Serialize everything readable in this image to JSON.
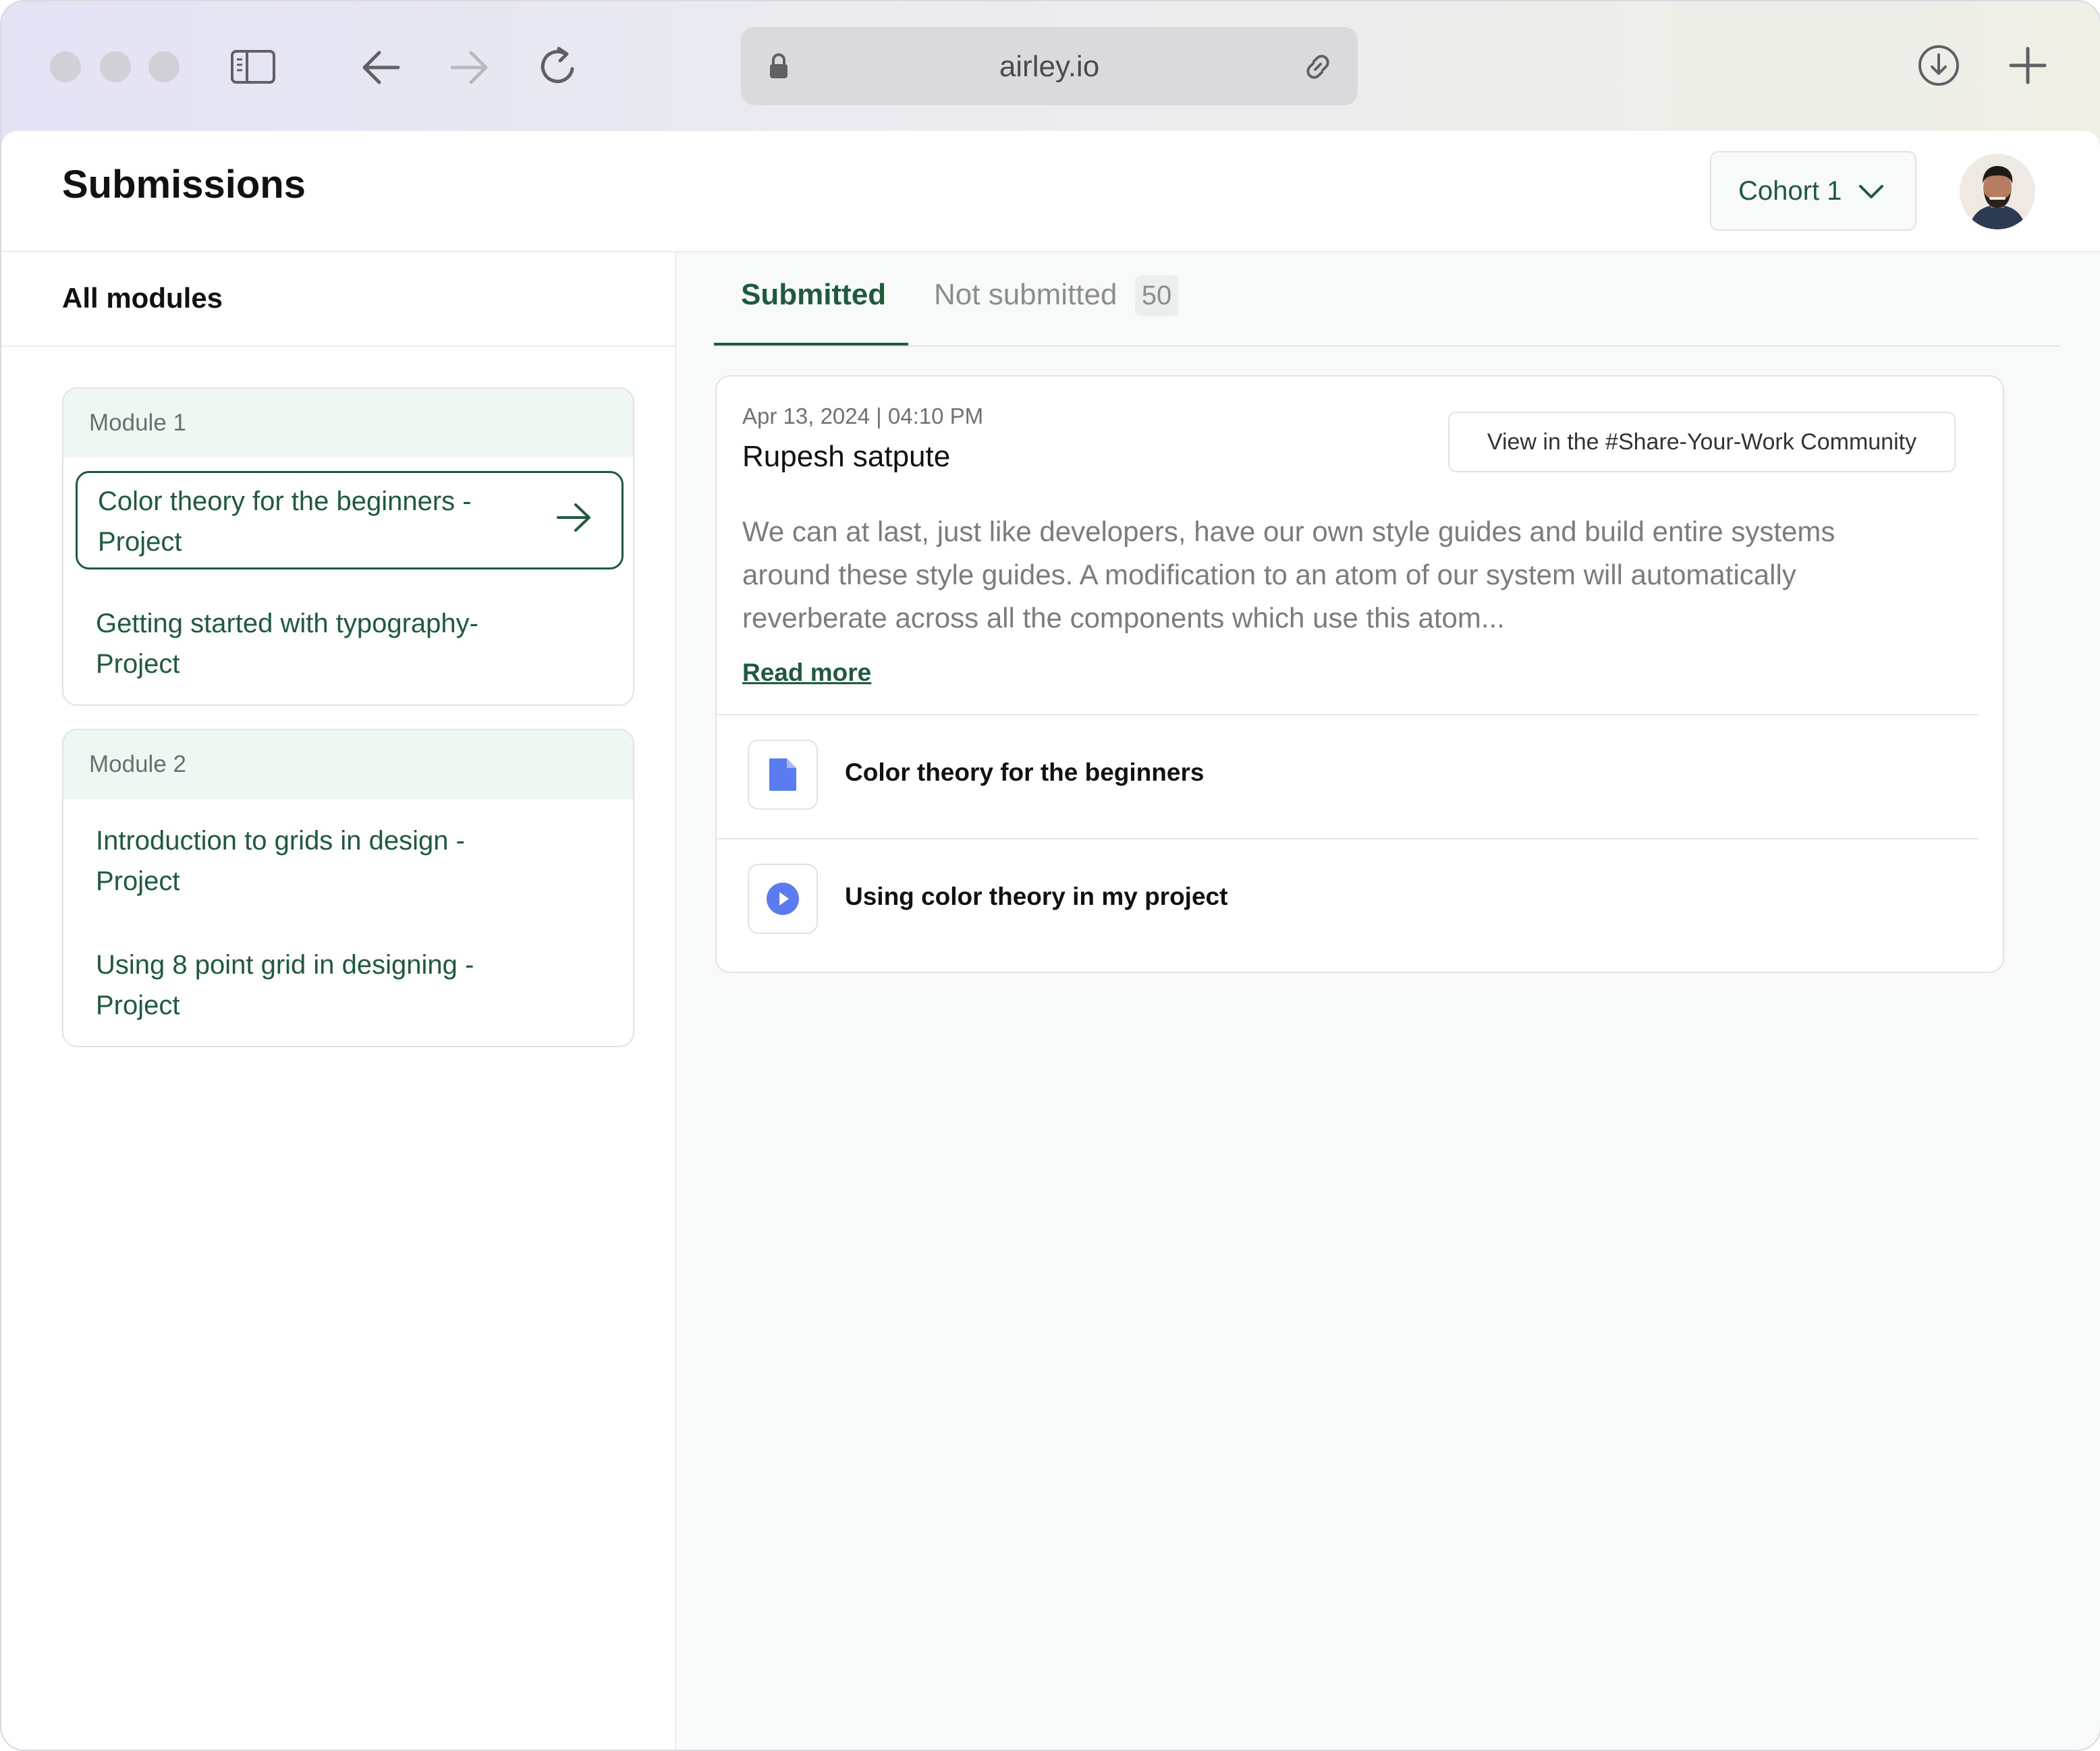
{
  "browser": {
    "url": "airley.io",
    "icons": [
      "sidebar-toggle-icon",
      "back-arrow-icon",
      "forward-arrow-icon",
      "reload-icon",
      "lock-icon",
      "link-icon",
      "download-icon",
      "plus-icon"
    ]
  },
  "header": {
    "title": "Submissions",
    "cohort_label": "Cohort 1"
  },
  "sidebar": {
    "title": "All modules",
    "modules": [
      {
        "name": "Module 1",
        "items": [
          {
            "label": "Color theory  for the beginners - Project",
            "active": true
          },
          {
            "label": "Getting started with typography- Project",
            "active": false
          }
        ]
      },
      {
        "name": "Module 2",
        "items": [
          {
            "label": "Introduction to grids in design - Project",
            "active": false
          },
          {
            "label": "Using 8 point grid in designing - Project",
            "active": false
          }
        ]
      }
    ]
  },
  "tabs": {
    "submitted": "Submitted",
    "not_submitted": "Not submitted",
    "not_submitted_count": "50"
  },
  "submission": {
    "date": "Apr 13, 2024 | 04:10 PM",
    "student": "Rupesh satpute",
    "community_button": "View in the #Share-Your-Work Community",
    "text": "We can at last, just like developers, have our own style guides and build entire systems around these style guides. A modification to an atom of our system will automatically reverberate across all the components which use this atom...",
    "read_more": "Read more",
    "attachments": [
      {
        "label": "Color theory  for the beginners",
        "icon": "document-icon"
      },
      {
        "label": "Using color theory in my project",
        "icon": "play-icon"
      }
    ]
  },
  "colors": {
    "accent": "#1e5b3c",
    "accent_light": "#eef7f1",
    "attachment_icon": "#5b7cf0"
  }
}
